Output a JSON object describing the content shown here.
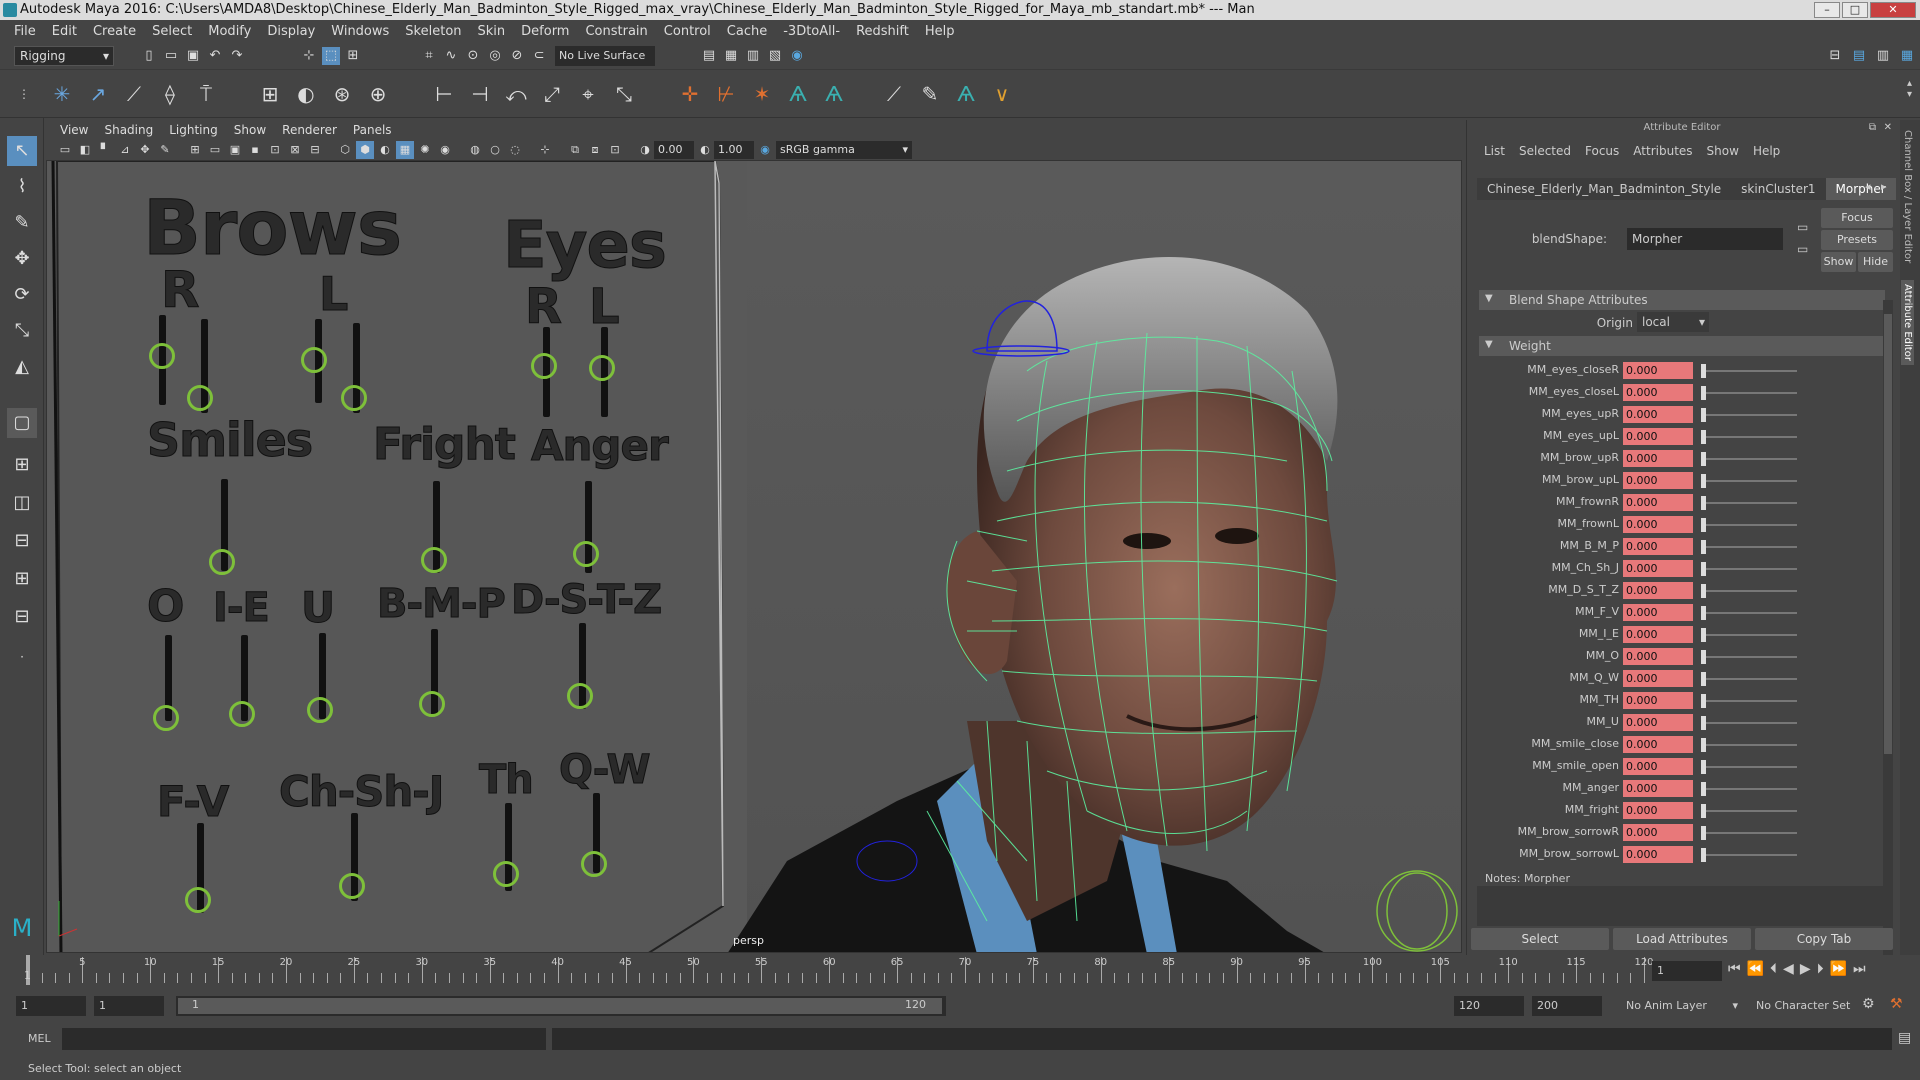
{
  "window": {
    "title": "Autodesk Maya 2016: C:\\Users\\AMDA8\\Desktop\\Chinese_Elderly_Man_Badminton_Style_Rigged_max_vray\\Chinese_Elderly_Man_Badminton_Style_Rigged_for_Maya_mb_standart.mb*   ---   Man",
    "btn_min": "–",
    "btn_max": "□",
    "btn_close": "✕"
  },
  "menubar": [
    "File",
    "Edit",
    "Create",
    "Select",
    "Modify",
    "Display",
    "Windows",
    "Skeleton",
    "Skin",
    "Deform",
    "Constrain",
    "Control",
    "Cache",
    "-3DtoAll-",
    "Redshift",
    "Help"
  ],
  "statusline": {
    "menu_set": "Rigging",
    "live_surface": "No Live Surface"
  },
  "viewport": {
    "menu": [
      "View",
      "Shading",
      "Lighting",
      "Show",
      "Renderer",
      "Panels"
    ],
    "field_a": "0.00",
    "field_b": "1.00",
    "color_space": "sRGB gamma",
    "camera": "persp",
    "labels": {
      "brows": "Brows",
      "eyes": "Eyes",
      "brow_r": "R",
      "brow_l": "L",
      "eye_r": "R",
      "eye_l": "L",
      "smiles": "Smiles",
      "fright": "Fright",
      "anger": "Anger",
      "o": "O",
      "ie": "I-E",
      "u": "U",
      "bmp": "B-M-P",
      "dstz": "D-S-T-Z",
      "fv": "F-V",
      "chshj": "Ch-Sh-J",
      "th": "Th",
      "qw": "Q-W"
    }
  },
  "attr_editor": {
    "header": "Attribute Editor",
    "menu": [
      "List",
      "Selected",
      "Focus",
      "Attributes",
      "Show",
      "Help"
    ],
    "tabs": [
      "Chinese_Elderly_Man_Badminton_Style",
      "skinCluster1",
      "Morpher"
    ],
    "blendshape_label": "blendShape:",
    "blendshape_value": "Morpher",
    "focus_btn": "Focus",
    "presets_btn": "Presets",
    "show_btn": "Show",
    "hide_btn": "Hide",
    "section_blend": "Blend Shape Attributes",
    "origin_label": "Origin",
    "origin_value": "local",
    "section_weight": "Weight",
    "weights": [
      {
        "name": "MM_eyes_closeR",
        "value": "0.000"
      },
      {
        "name": "MM_eyes_closeL",
        "value": "0.000"
      },
      {
        "name": "MM_eyes_upR",
        "value": "0.000"
      },
      {
        "name": "MM_eyes_upL",
        "value": "0.000"
      },
      {
        "name": "MM_brow_upR",
        "value": "0.000"
      },
      {
        "name": "MM_brow_upL",
        "value": "0.000"
      },
      {
        "name": "MM_frownR",
        "value": "0.000"
      },
      {
        "name": "MM_frownL",
        "value": "0.000"
      },
      {
        "name": "MM_B_M_P",
        "value": "0.000"
      },
      {
        "name": "MM_Ch_Sh_J",
        "value": "0.000"
      },
      {
        "name": "MM_D_S_T_Z",
        "value": "0.000"
      },
      {
        "name": "MM_F_V",
        "value": "0.000"
      },
      {
        "name": "MM_I_E",
        "value": "0.000"
      },
      {
        "name": "MM_O",
        "value": "0.000"
      },
      {
        "name": "MM_Q_W",
        "value": "0.000"
      },
      {
        "name": "MM_TH",
        "value": "0.000"
      },
      {
        "name": "MM_U",
        "value": "0.000"
      },
      {
        "name": "MM_smile_close",
        "value": "0.000"
      },
      {
        "name": "MM_smile_open",
        "value": "0.000"
      },
      {
        "name": "MM_anger",
        "value": "0.000"
      },
      {
        "name": "MM_fright",
        "value": "0.000"
      },
      {
        "name": "MM_brow_sorrowR",
        "value": "0.000"
      },
      {
        "name": "MM_brow_sorrowL",
        "value": "0.000"
      }
    ],
    "notes_label": "Notes:  Morpher",
    "btn_select": "Select",
    "btn_load": "Load Attributes",
    "btn_copy": "Copy Tab",
    "side_tabs": [
      "Channel Box / Layer Editor",
      "Attribute Editor"
    ]
  },
  "timeline": {
    "ticks": [
      "5",
      "10",
      "15",
      "20",
      "25",
      "30",
      "35",
      "40",
      "45",
      "50",
      "55",
      "60",
      "65",
      "70",
      "75",
      "80",
      "85",
      "90",
      "95",
      "100",
      "105",
      "110",
      "115",
      "120"
    ],
    "start_tick": "1",
    "current_frame": "1"
  },
  "range": {
    "start": "1",
    "playback_start": "1",
    "slider_start": "1",
    "slider_end": "120",
    "playback_end": "120",
    "end": "200",
    "anim_layer": "No Anim Layer",
    "char_set": "No Character Set"
  },
  "cmdline": {
    "label": "MEL"
  },
  "helpline": {
    "text": "Select Tool: select an object"
  },
  "colors": {
    "wire": "#5cf0a0",
    "ring": "#7ec03a",
    "field": "#e8787a",
    "accent": "#5a8fbf"
  }
}
